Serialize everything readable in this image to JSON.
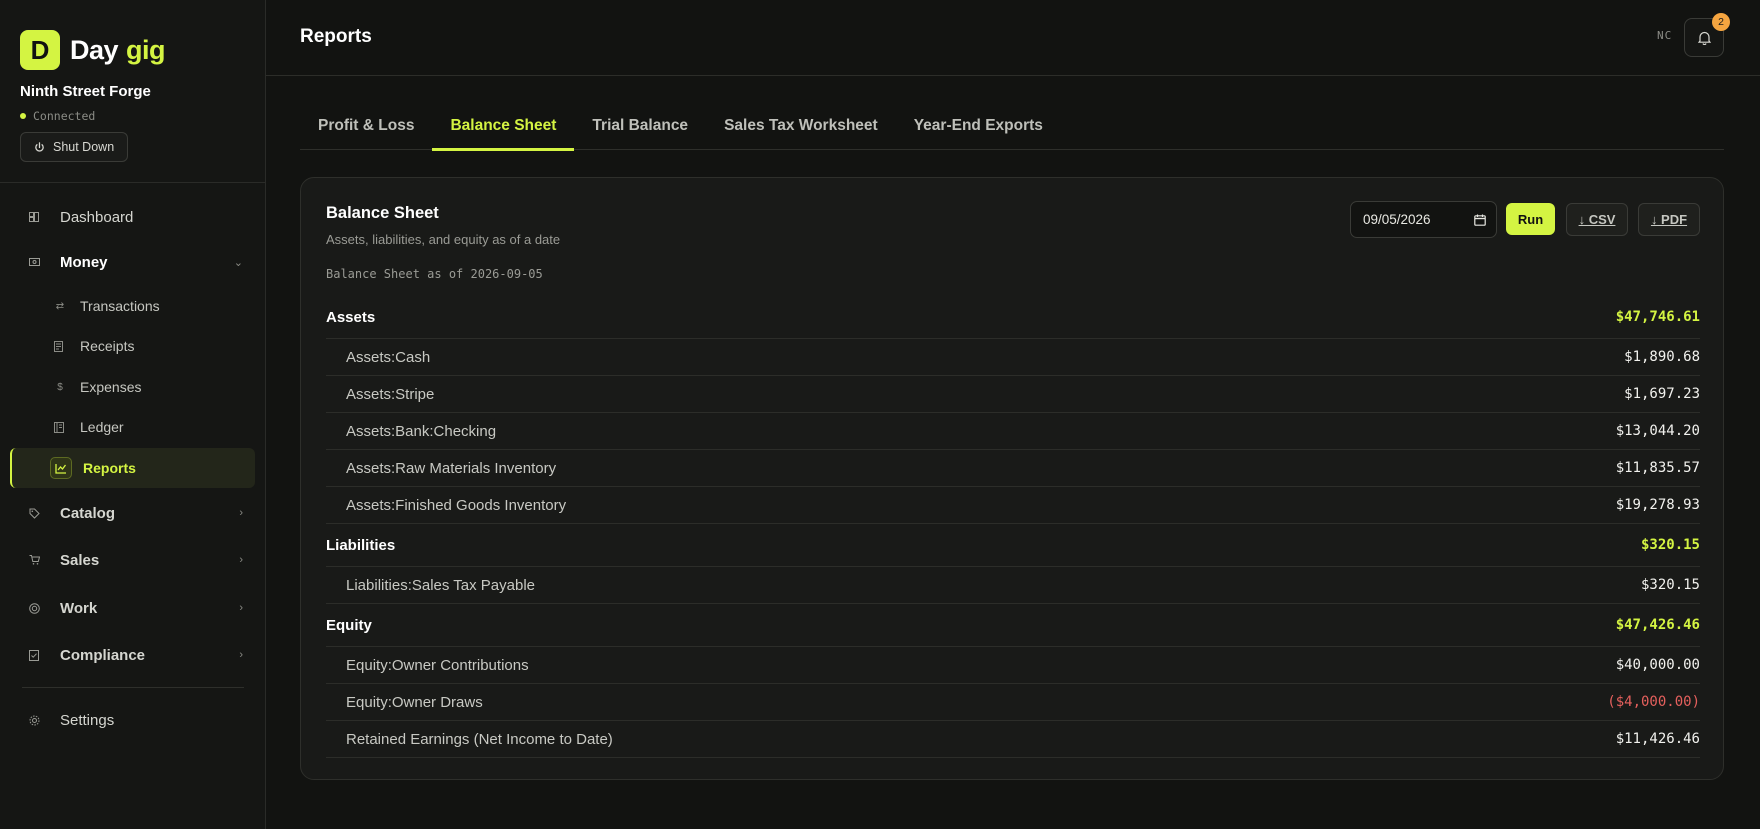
{
  "brand": {
    "logo_letter": "D",
    "name_part1": "Day",
    "name_part2": "gig",
    "accent_color": "#d4f442"
  },
  "org": {
    "name": "Ninth Street Forge",
    "status": "Connected",
    "shutdown_label": "Shut Down"
  },
  "nav": {
    "dashboard": {
      "label": "Dashboard",
      "icon": "dashboard-icon"
    },
    "money": {
      "label": "Money",
      "icon": "money-icon",
      "items": [
        {
          "label": "Transactions",
          "icon": "arrows-icon"
        },
        {
          "label": "Receipts",
          "icon": "receipt-icon"
        },
        {
          "label": "Expenses",
          "icon": "dollar-icon"
        },
        {
          "label": "Ledger",
          "icon": "ledger-icon"
        },
        {
          "label": "Reports",
          "icon": "chart-icon"
        }
      ]
    },
    "catalog": {
      "label": "Catalog",
      "icon": "tag-icon"
    },
    "sales": {
      "label": "Sales",
      "icon": "cart-icon"
    },
    "work": {
      "label": "Work",
      "icon": "target-icon"
    },
    "compliance": {
      "label": "Compliance",
      "icon": "checklist-icon"
    },
    "settings": {
      "label": "Settings",
      "icon": "gear-icon"
    }
  },
  "header": {
    "title": "Reports",
    "user_initials": "NC",
    "notification_count": "2"
  },
  "tabs": [
    {
      "label": "Profit & Loss"
    },
    {
      "label": "Balance Sheet"
    },
    {
      "label": "Trial Balance"
    },
    {
      "label": "Sales Tax Worksheet"
    },
    {
      "label": "Year-End Exports"
    }
  ],
  "report": {
    "title": "Balance Sheet",
    "subtitle": "Assets, liabilities, and equity as of a date",
    "date_value": "09/05/2026",
    "run_label": "Run",
    "csv_label": "↓ CSV",
    "pdf_label": "↓ PDF",
    "heading": "Balance Sheet as of 2026-09-05",
    "sections": [
      {
        "name": "Assets",
        "total": "$47,746.61",
        "rows": [
          {
            "name": "Assets:Cash",
            "amount": "$1,890.68"
          },
          {
            "name": "Assets:Stripe",
            "amount": "$1,697.23"
          },
          {
            "name": "Assets:Bank:Checking",
            "amount": "$13,044.20"
          },
          {
            "name": "Assets:Raw Materials Inventory",
            "amount": "$11,835.57"
          },
          {
            "name": "Assets:Finished Goods Inventory",
            "amount": "$19,278.93"
          }
        ]
      },
      {
        "name": "Liabilities",
        "total": "$320.15",
        "rows": [
          {
            "name": "Liabilities:Sales Tax Payable",
            "amount": "$320.15"
          }
        ]
      },
      {
        "name": "Equity",
        "total": "$47,426.46",
        "rows": [
          {
            "name": "Equity:Owner Contributions",
            "amount": "$40,000.00"
          },
          {
            "name": "Equity:Owner Draws",
            "amount": "($4,000.00)"
          },
          {
            "name": "Retained Earnings (Net Income to Date)",
            "amount": "$11,426.46"
          }
        ]
      }
    ]
  }
}
